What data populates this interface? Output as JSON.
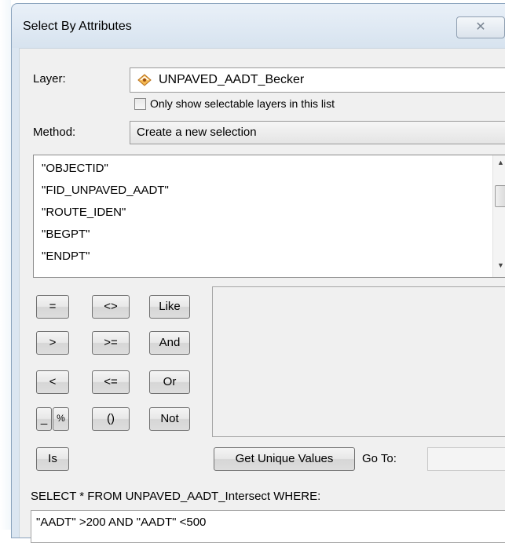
{
  "window": {
    "title": "Select By Attributes",
    "close_glyph": "✕"
  },
  "layer": {
    "label": "Layer:",
    "value": "UNPAVED_AADT_Becker",
    "icon": "layer-icon",
    "only_selectable_label": "Only show selectable layers in this list",
    "only_selectable_checked": false
  },
  "method": {
    "label": "Method:",
    "value": "Create a new selection"
  },
  "fields": [
    "\"OBJECTID\"",
    "\"FID_UNPAVED_AADT\"",
    "\"ROUTE_IDEN\"",
    "\"BEGPT\"",
    "\"ENDPT\""
  ],
  "operators": {
    "eq": "=",
    "ne": "<>",
    "like": "Like",
    "gt": ">",
    "ge": ">=",
    "and": "And",
    "lt": "<",
    "le": "<=",
    "or": "Or",
    "underscore": "_",
    "percent": "%",
    "parens": "()",
    "not": "Not",
    "is": "Is"
  },
  "buttons": {
    "get_unique_values": "Get Unique Values",
    "goto_label": "Go To:"
  },
  "query": {
    "prefix": "SELECT * FROM UNPAVED_AADT_Intersect WHERE:",
    "where_clause": "\"AADT\" >200 AND \"AADT\" <500"
  },
  "colors": {
    "title_bar": "#dbe6f1",
    "client": "#f0f0f0",
    "layer_icon": "#e8a23c"
  }
}
